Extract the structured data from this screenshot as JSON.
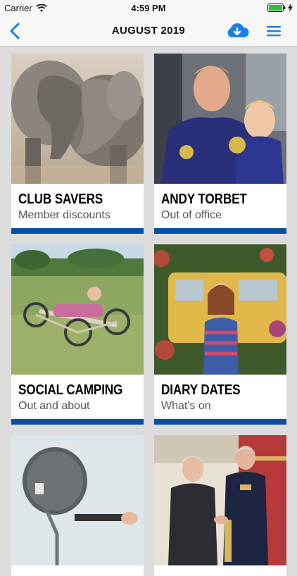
{
  "status_bar": {
    "carrier": "Carrier",
    "time": "4:59 PM"
  },
  "nav": {
    "title": "AUGUST 2019"
  },
  "cards": [
    {
      "title": "CLUB SAVERS",
      "subtitle": "Member discounts"
    },
    {
      "title": "ANDY TORBET",
      "subtitle": "Out of office"
    },
    {
      "title": "SOCIAL CAMPING",
      "subtitle": "Out and about"
    },
    {
      "title": "DIARY DATES",
      "subtitle": "What's on"
    },
    {
      "title": "",
      "subtitle": ""
    },
    {
      "title": "",
      "subtitle": ""
    }
  ],
  "colors": {
    "accent": "#1a7fe8",
    "card_bar": "#0b4fa0",
    "background": "#dcdcdc"
  }
}
